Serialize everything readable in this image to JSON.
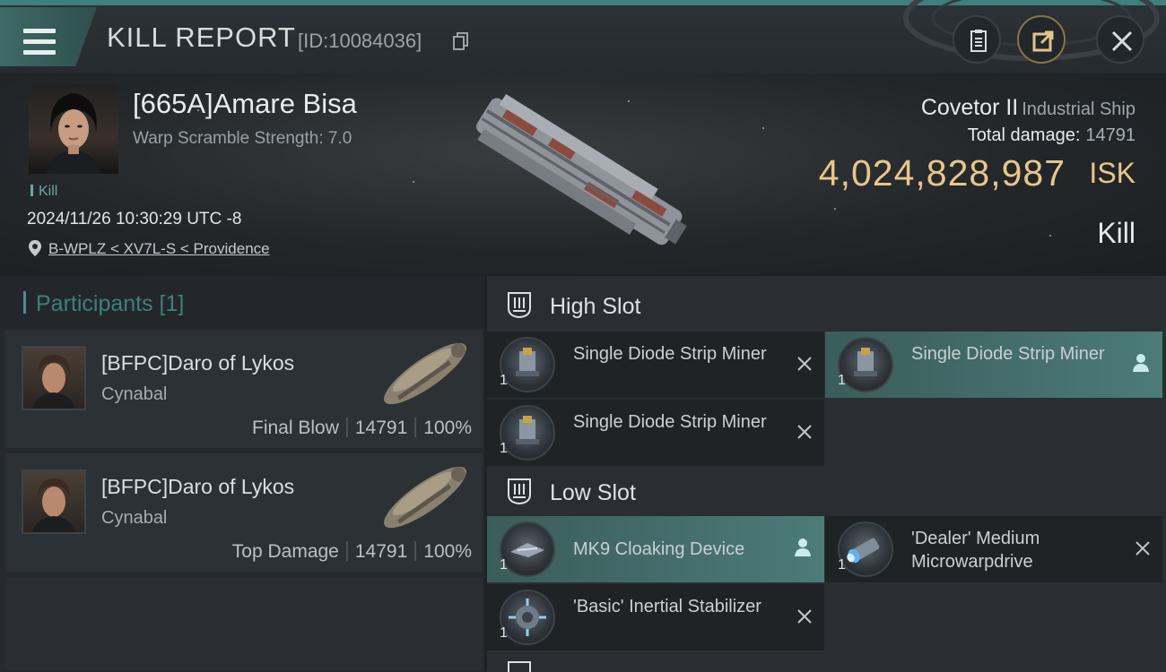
{
  "header": {
    "title": "KILL REPORT",
    "report_id": "[ID:10084036]"
  },
  "victim": {
    "name": "[665A]Amare Bisa",
    "warp_scramble": "Warp Scramble Strength: 7.0",
    "kill_tag": "Kill",
    "datetime": "2024/11/26 10:30:29 UTC -8",
    "location": "B-WPLZ < XV7L-S < Providence"
  },
  "ship": {
    "name": "Covetor II",
    "class": "Industrial Ship",
    "total_damage_label": "Total damage:",
    "total_damage_value": "14791",
    "isk_value": "4,024,828,987",
    "isk_unit": "ISK",
    "result": "Kill"
  },
  "participants": {
    "title": "Participants [1]",
    "items": [
      {
        "name": "[BFPC]Daro of Lykos",
        "ship": "Cynabal",
        "role": "Final Blow",
        "damage": "14791",
        "percent": "100%"
      },
      {
        "name": "[BFPC]Daro of Lykos",
        "ship": "Cynabal",
        "role": "Top Damage",
        "damage": "14791",
        "percent": "100%"
      }
    ]
  },
  "fitting": {
    "high_slot": {
      "title": "High Slot",
      "modules": [
        {
          "name": "Single Diode Strip Miner",
          "qty": "1",
          "status": "destroyed"
        },
        {
          "name": "Single Diode Strip Miner",
          "qty": "1",
          "status": "dropped"
        },
        {
          "name": "Single Diode Strip Miner",
          "qty": "1",
          "status": "destroyed"
        }
      ]
    },
    "low_slot": {
      "title": "Low Slot",
      "modules": [
        {
          "name": "MK9 Cloaking Device",
          "qty": "1",
          "status": "dropped"
        },
        {
          "name": "'Dealer' Medium Microwarpdrive",
          "qty": "1",
          "status": "destroyed"
        },
        {
          "name": "'Basic' Inertial Stabilizer",
          "qty": "1",
          "status": "destroyed"
        }
      ]
    }
  },
  "colors": {
    "accent_teal": "#3f7f7c",
    "isk_gold": "#e8c68a",
    "highlight_row": "#4c7b78"
  },
  "icons": [
    "menu-icon",
    "copy-icon",
    "notes-icon",
    "share-icon",
    "close-icon",
    "location-pin-icon",
    "slot-icon",
    "destroyed-x-icon",
    "dropped-person-icon"
  ]
}
